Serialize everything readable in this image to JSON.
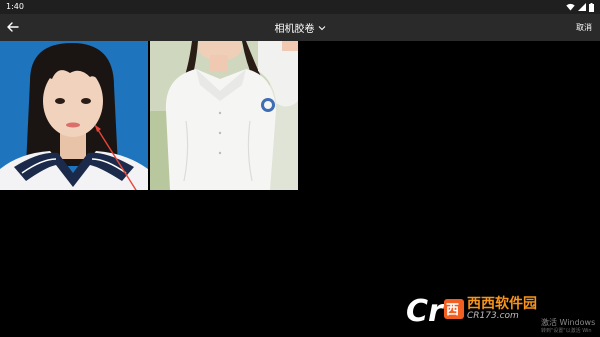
{
  "status_bar": {
    "time": "1:40",
    "icons": [
      "wifi-icon",
      "signal-icon",
      "battery-icon"
    ]
  },
  "app_bar": {
    "back_icon": "arrow-left-icon",
    "title": "相机胶卷",
    "title_dropdown_icon": "chevron-down-icon",
    "cancel_label": "取消"
  },
  "photos": [
    {
      "description_icon": "photo",
      "selected": false
    },
    {
      "description_icon": "photo",
      "selected": false
    }
  ],
  "watermark": {
    "name": "西西软件园",
    "domain": "CR173.com"
  },
  "activation_notice": {
    "line1": "激活 Windows",
    "line2": "转到\"设置\"以激活 Win"
  },
  "colors": {
    "status_bar": "#1f1f1f",
    "app_bar": "#2a2a2a",
    "background": "#000000",
    "photo1_bg": "#1e74bd",
    "arrow": "#e8463a"
  }
}
